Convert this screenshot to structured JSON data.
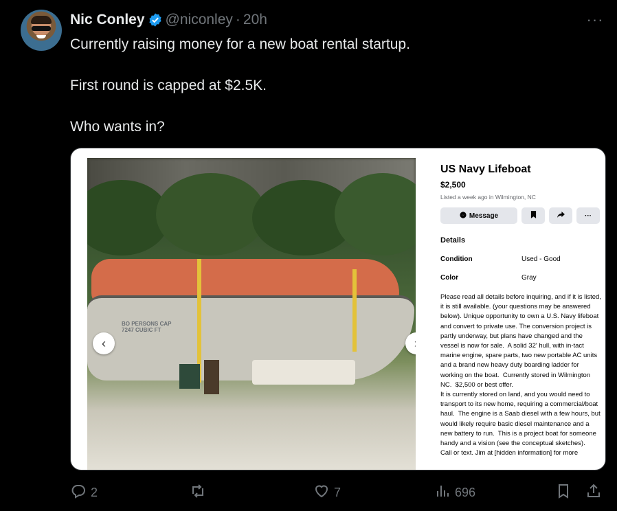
{
  "tweet": {
    "author_name": "Nic Conley",
    "handle": "@niconley",
    "separator": "·",
    "time": "20h",
    "more": "···",
    "text": "Currently raising money for a new boat rental startup.\n\nFirst round is capped at $2.5K.\n\nWho wants in?"
  },
  "photo": {
    "hull_text": "BO PERSONS CAP\n7247 CUBIC FT",
    "prev_arrow": "‹",
    "next_arrow": "›"
  },
  "listing": {
    "title": "US Navy Lifeboat",
    "price": "$2,500",
    "meta": "Listed a week ago in Wilmington, NC",
    "actions": {
      "message": "Message",
      "more": "···"
    },
    "details_heading": "Details",
    "condition_label": "Condition",
    "condition_value": "Used - Good",
    "color_label": "Color",
    "color_value": "Gray",
    "description": "Please read all details before inquiring, and if it is listed, it is still available. (your questions may be answered below). Unique opportunity to own a U.S. Navy lifeboat and convert to private use. The conversion project is partly underway, but plans have changed and the vessel is now for sale.  A solid 32' hull, with in-tact marine engine, spare parts, two new portable AC units and a brand new heavy duty boarding ladder for working on the boat.  Currently stored in Wilmington NC.  $2,500 or best offer.\nIt is currently stored on land, and you would need to transport to its new home, requiring a commercial/boat haul.  The engine is a Saab diesel with a few hours, but would likely require basic diesel maintenance and a new battery to run.  This is a project boat for someone handy and a vision (see the conceptual sketches).\nCall or text. Jim at [hidden information] for more"
  },
  "footer": {
    "replies": "2",
    "reposts": "",
    "likes": "7",
    "views": "696"
  },
  "colors": {
    "background": "#000000",
    "text": "#e7e9ea",
    "muted": "#71767b",
    "verified": "#1d9bf0"
  }
}
